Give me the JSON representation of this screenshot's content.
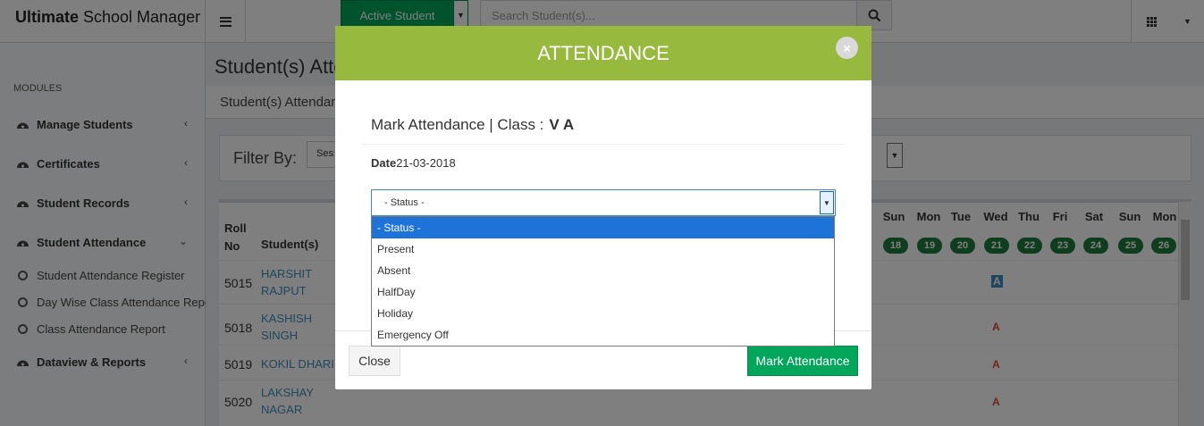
{
  "app": {
    "title_bold": "Ultimate",
    "title_rest": " School Manager"
  },
  "topbar": {
    "active_student_label": "Active Student",
    "search_placeholder": "Search Student(s)..."
  },
  "sidebar": {
    "header": "MODULES",
    "items": [
      {
        "label": "Manage Students",
        "chev": "‹"
      },
      {
        "label": "Certificates",
        "chev": "‹"
      },
      {
        "label": "Student Records",
        "chev": "‹"
      },
      {
        "label": "Student Attendance",
        "chev": "⌄"
      },
      {
        "label": "Dataview & Reports",
        "chev": "‹"
      }
    ],
    "sub_items": [
      {
        "label": "Student Attendance Register"
      },
      {
        "label": "Day Wise Class Attendance Report"
      },
      {
        "label": "Class Attendance Report"
      }
    ]
  },
  "page": {
    "title": "Student(s) Attendance",
    "breadcrumb": "Student(s) Attendance",
    "filter_label": "Filter By:",
    "filter_session": "Session"
  },
  "table": {
    "header_roll": "Roll\nNo",
    "header_roll_1": "Roll",
    "header_roll_2": "No",
    "header_student": "Student(s)",
    "days": [
      {
        "dow": "Sun",
        "num": "18"
      },
      {
        "dow": "Mon",
        "num": "19"
      },
      {
        "dow": "Tue",
        "num": "20"
      },
      {
        "dow": "Wed",
        "num": "21"
      },
      {
        "dow": "Thu",
        "num": "22"
      },
      {
        "dow": "Fri",
        "num": "23"
      },
      {
        "dow": "Sat",
        "num": "24"
      },
      {
        "dow": "Sun",
        "num": "25"
      },
      {
        "dow": "Mon",
        "num": "26"
      }
    ],
    "rows": [
      {
        "roll": "5015",
        "name1": "HARSHIT",
        "name2": "RAJPUT",
        "mark": "A"
      },
      {
        "roll": "5018",
        "name1": "KASHISH",
        "name2": "SINGH",
        "mark": "A"
      },
      {
        "roll": "5019",
        "name1": "KOKIL DHARI",
        "name2": "",
        "mark": "A"
      },
      {
        "roll": "5020",
        "name1": "LAKSHAY",
        "name2": "NAGAR",
        "mark": "A"
      }
    ]
  },
  "modal": {
    "title": "ATTENDANCE",
    "close_glyph": "×",
    "subtitle_prefix": "Mark Attendance | Class :",
    "class_name": "V A",
    "date_label": "Date",
    "date_value": "21-03-2018",
    "status_value": "- Status -",
    "status_options": [
      "- Status -",
      "Present",
      "Absent",
      "HalfDay",
      "Holiday",
      "Emergency Off"
    ],
    "close_label": "Close",
    "submit_label": "Mark Attendance"
  },
  "colors": {
    "modal_header": "#97b93e",
    "primary_green": "#00a65a",
    "link_blue": "#3c8dbc",
    "absent_red": "#dd4b39",
    "day_badge": "#1e7d3d"
  }
}
